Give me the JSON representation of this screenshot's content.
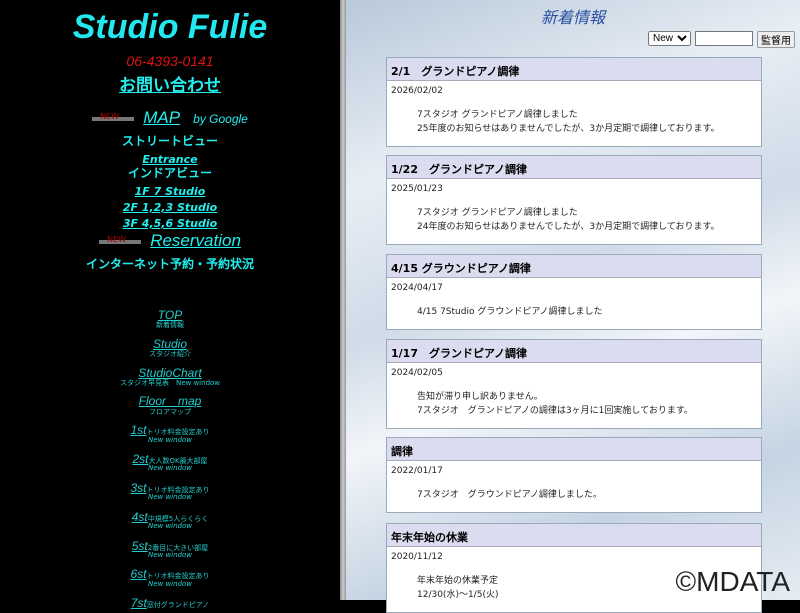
{
  "left": {
    "title": "Studio Fulie",
    "phone": "06-4393-0141",
    "contact": "お問い合わせ",
    "new_badge": "NEW",
    "map": "MAP",
    "by_google": "by Google",
    "street_view": "ストリートビュー",
    "entrance": "Entrance",
    "indoor_view": "インドアビュー",
    "floors": [
      "1F 7 Studio",
      "2F 1,2,3 Studio",
      "3F 4,5,6 Studio"
    ],
    "reservation": "Reservation",
    "reservation_sub": "インターネット予約・予約状況",
    "nav": [
      {
        "label": "TOP",
        "sub": "新着情報"
      },
      {
        "label": "Studio",
        "sub": "スタジオ紹介"
      },
      {
        "label": "StudioChart",
        "sub": "スタジオ早見表　New window"
      },
      {
        "label": "Floor　map",
        "sub": "フロアマップ"
      }
    ],
    "studios": [
      {
        "label": "1st",
        "desc": "トリオ料金設定あり",
        "nw": "New window"
      },
      {
        "label": "2st",
        "desc": "大人数OK最大部屋",
        "nw": "New window"
      },
      {
        "label": "3st",
        "desc": "トリオ料金設定あり",
        "nw": "New window"
      },
      {
        "label": "4st",
        "desc": "中規模5人らくらく",
        "nw": "New window"
      },
      {
        "label": "5st",
        "desc": "2番目に大きい部屋",
        "nw": "New window"
      },
      {
        "label": "6st",
        "desc": "トリオ料金設定あり",
        "nw": "New window"
      },
      {
        "label": "7st",
        "desc": "窓付グランドピアノ",
        "nw": ""
      }
    ]
  },
  "right": {
    "heading": "新着情報",
    "select": "New",
    "search_value": "",
    "admin_button": "監督用",
    "news": [
      {
        "title": "2/1　グランドピアノ調律",
        "date": "2026/02/02",
        "lines": [
          "7スタジオ グランドピアノ調律しました",
          "25年度のお知らせはありませんでしたが、3か月定期で調律しております。"
        ]
      },
      {
        "title": "1/22　グランドピアノ調律",
        "date": "2025/01/23",
        "lines": [
          "7スタジオ グランドピアノ調律しました",
          "24年度のお知らせはありませんでしたが、3か月定期で調律しております。"
        ]
      },
      {
        "title": "4/15 グラウンドピアノ調律",
        "date": "2024/04/17",
        "lines": [
          "4/15 7Studio グラウンドピアノ調律しました"
        ]
      },
      {
        "title": "1/17　グランドピアノ調律",
        "date": "2024/02/05",
        "lines": [
          "告知が滞り申し訳ありません。",
          "7スタジオ　グランドピアノの調律は3ヶ月に1回実施しております。"
        ]
      },
      {
        "title": "調律",
        "date": "2022/01/17",
        "lines": [
          "7スタジオ　グラウンドピアノ調律しました。"
        ]
      },
      {
        "title": "年末年始の休業",
        "date": "2020/11/12",
        "lines": [
          "年末年始の休業予定",
          "12/30(水)～1/5(火)"
        ]
      }
    ]
  },
  "watermark": "©MDATA"
}
